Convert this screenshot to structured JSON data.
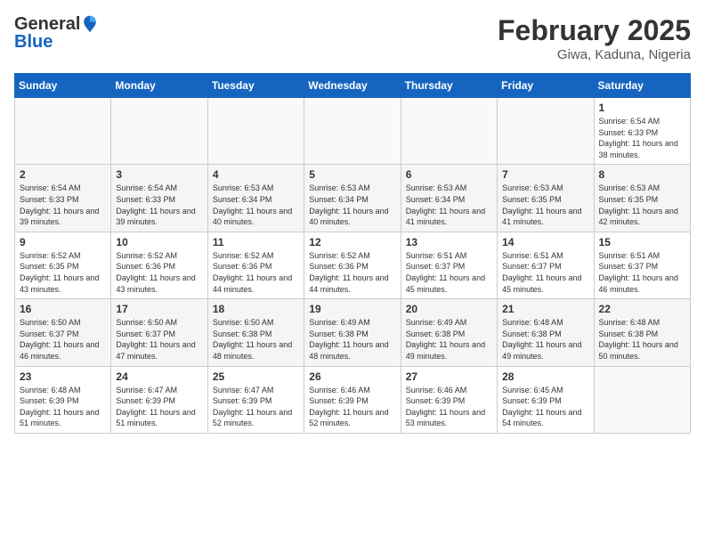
{
  "logo": {
    "general": "General",
    "blue": "Blue"
  },
  "title": {
    "month_year": "February 2025",
    "location": "Giwa, Kaduna, Nigeria"
  },
  "days_of_week": [
    "Sunday",
    "Monday",
    "Tuesday",
    "Wednesday",
    "Thursday",
    "Friday",
    "Saturday"
  ],
  "weeks": [
    [
      {
        "day": "",
        "info": ""
      },
      {
        "day": "",
        "info": ""
      },
      {
        "day": "",
        "info": ""
      },
      {
        "day": "",
        "info": ""
      },
      {
        "day": "",
        "info": ""
      },
      {
        "day": "",
        "info": ""
      },
      {
        "day": "1",
        "info": "Sunrise: 6:54 AM\nSunset: 6:33 PM\nDaylight: 11 hours and 38 minutes."
      }
    ],
    [
      {
        "day": "2",
        "info": "Sunrise: 6:54 AM\nSunset: 6:33 PM\nDaylight: 11 hours and 39 minutes."
      },
      {
        "day": "3",
        "info": "Sunrise: 6:54 AM\nSunset: 6:33 PM\nDaylight: 11 hours and 39 minutes."
      },
      {
        "day": "4",
        "info": "Sunrise: 6:53 AM\nSunset: 6:34 PM\nDaylight: 11 hours and 40 minutes."
      },
      {
        "day": "5",
        "info": "Sunrise: 6:53 AM\nSunset: 6:34 PM\nDaylight: 11 hours and 40 minutes."
      },
      {
        "day": "6",
        "info": "Sunrise: 6:53 AM\nSunset: 6:34 PM\nDaylight: 11 hours and 41 minutes."
      },
      {
        "day": "7",
        "info": "Sunrise: 6:53 AM\nSunset: 6:35 PM\nDaylight: 11 hours and 41 minutes."
      },
      {
        "day": "8",
        "info": "Sunrise: 6:53 AM\nSunset: 6:35 PM\nDaylight: 11 hours and 42 minutes."
      }
    ],
    [
      {
        "day": "9",
        "info": "Sunrise: 6:52 AM\nSunset: 6:35 PM\nDaylight: 11 hours and 43 minutes."
      },
      {
        "day": "10",
        "info": "Sunrise: 6:52 AM\nSunset: 6:36 PM\nDaylight: 11 hours and 43 minutes."
      },
      {
        "day": "11",
        "info": "Sunrise: 6:52 AM\nSunset: 6:36 PM\nDaylight: 11 hours and 44 minutes."
      },
      {
        "day": "12",
        "info": "Sunrise: 6:52 AM\nSunset: 6:36 PM\nDaylight: 11 hours and 44 minutes."
      },
      {
        "day": "13",
        "info": "Sunrise: 6:51 AM\nSunset: 6:37 PM\nDaylight: 11 hours and 45 minutes."
      },
      {
        "day": "14",
        "info": "Sunrise: 6:51 AM\nSunset: 6:37 PM\nDaylight: 11 hours and 45 minutes."
      },
      {
        "day": "15",
        "info": "Sunrise: 6:51 AM\nSunset: 6:37 PM\nDaylight: 11 hours and 46 minutes."
      }
    ],
    [
      {
        "day": "16",
        "info": "Sunrise: 6:50 AM\nSunset: 6:37 PM\nDaylight: 11 hours and 46 minutes."
      },
      {
        "day": "17",
        "info": "Sunrise: 6:50 AM\nSunset: 6:37 PM\nDaylight: 11 hours and 47 minutes."
      },
      {
        "day": "18",
        "info": "Sunrise: 6:50 AM\nSunset: 6:38 PM\nDaylight: 11 hours and 48 minutes."
      },
      {
        "day": "19",
        "info": "Sunrise: 6:49 AM\nSunset: 6:38 PM\nDaylight: 11 hours and 48 minutes."
      },
      {
        "day": "20",
        "info": "Sunrise: 6:49 AM\nSunset: 6:38 PM\nDaylight: 11 hours and 49 minutes."
      },
      {
        "day": "21",
        "info": "Sunrise: 6:48 AM\nSunset: 6:38 PM\nDaylight: 11 hours and 49 minutes."
      },
      {
        "day": "22",
        "info": "Sunrise: 6:48 AM\nSunset: 6:38 PM\nDaylight: 11 hours and 50 minutes."
      }
    ],
    [
      {
        "day": "23",
        "info": "Sunrise: 6:48 AM\nSunset: 6:39 PM\nDaylight: 11 hours and 51 minutes."
      },
      {
        "day": "24",
        "info": "Sunrise: 6:47 AM\nSunset: 6:39 PM\nDaylight: 11 hours and 51 minutes."
      },
      {
        "day": "25",
        "info": "Sunrise: 6:47 AM\nSunset: 6:39 PM\nDaylight: 11 hours and 52 minutes."
      },
      {
        "day": "26",
        "info": "Sunrise: 6:46 AM\nSunset: 6:39 PM\nDaylight: 11 hours and 52 minutes."
      },
      {
        "day": "27",
        "info": "Sunrise: 6:46 AM\nSunset: 6:39 PM\nDaylight: 11 hours and 53 minutes."
      },
      {
        "day": "28",
        "info": "Sunrise: 6:45 AM\nSunset: 6:39 PM\nDaylight: 11 hours and 54 minutes."
      },
      {
        "day": "",
        "info": ""
      }
    ]
  ]
}
